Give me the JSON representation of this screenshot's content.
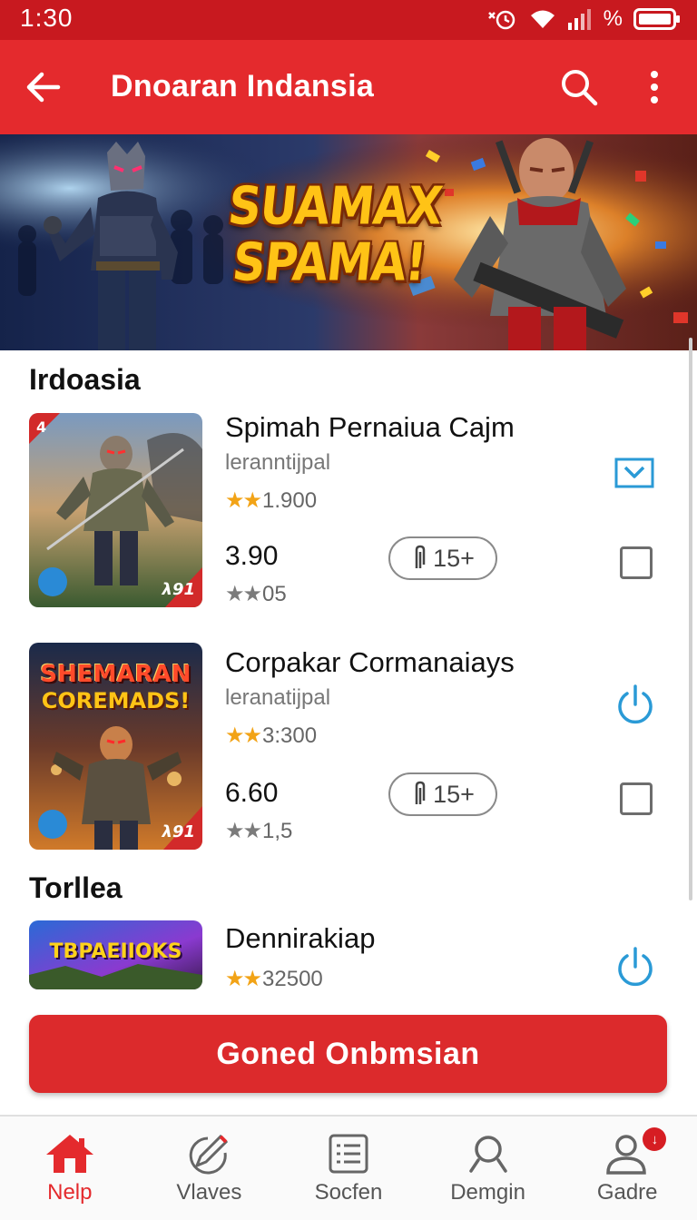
{
  "status_bar": {
    "time": "1:30",
    "battery_text": "%"
  },
  "app_bar": {
    "title": "Dnoaran Indansia"
  },
  "banner": {
    "headline_line1": "SUAMAX",
    "headline_line2": "SPAMA!"
  },
  "sections": [
    {
      "title": "Irdoasia",
      "apps": [
        {
          "name": "Spimah Pernaiua Cajm",
          "developer": "leranntĳpal",
          "rating_text": "1.900",
          "price": "3.90",
          "sub_rating": "05",
          "age": "15+",
          "thumb_corner": "4",
          "thumb_tag": "λ91",
          "action": "download",
          "action_color": "#2a9ad6"
        },
        {
          "name": "Corpakar Cormanaiays",
          "developer": "leranatĳpal",
          "rating_text": "3:300",
          "price": "6.60",
          "sub_rating": "1,5",
          "age": "15+",
          "thumb_line1": "SHEMARAN",
          "thumb_line2": "COREMADS!",
          "thumb_tag": "λ91",
          "action": "power",
          "action_color": "#2a9ad6"
        }
      ]
    },
    {
      "title": "Torllea",
      "apps": [
        {
          "name": "Dennirakiap",
          "rating_text": "32500",
          "thumb_text": "TBPAEIIOKS",
          "action": "power",
          "action_color": "#2a9ad6"
        }
      ]
    }
  ],
  "main_button": {
    "label": "Goned Onbmsian"
  },
  "bottom_nav": [
    {
      "label": "Nelp",
      "icon": "home-icon",
      "active": true
    },
    {
      "label": "Vlaves",
      "icon": "pen-icon"
    },
    {
      "label": "Socfen",
      "icon": "list-icon"
    },
    {
      "label": "Demgin",
      "icon": "search-icon"
    },
    {
      "label": "Gadre",
      "icon": "profile-icon",
      "badge": "↓"
    }
  ],
  "colors": {
    "status_bar": "#c8191f",
    "app_bar": "#e42a2d",
    "primary_button": "#dc2a2c",
    "star": "#f2a316",
    "accent_blue": "#2a9ad6"
  }
}
